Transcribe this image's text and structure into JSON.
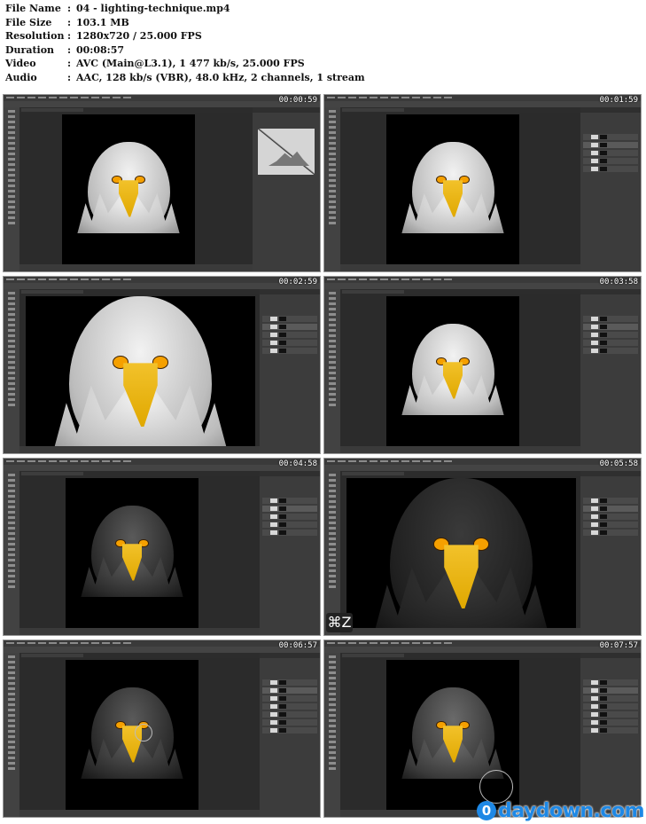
{
  "file_info": [
    {
      "key": "File Name",
      "value": "04 - lighting-technique.mp4"
    },
    {
      "key": "File Size",
      "value": "103.1 MB"
    },
    {
      "key": "Resolution",
      "value": "1280x720 / 25.000 FPS"
    },
    {
      "key": "Duration",
      "value": "00:08:57"
    },
    {
      "key": "Video",
      "value": "AVC (Main@L3.1), 1 477 kb/s, 25.000 FPS"
    },
    {
      "key": "Audio",
      "value": "AAC, 128 kb/s (VBR), 48.0 kHz, 2 channels, 1 stream"
    }
  ],
  "separator": ":",
  "thumbnails": [
    {
      "timestamp": "00:00:59",
      "variant": "white",
      "panel": "properties"
    },
    {
      "timestamp": "00:01:59",
      "variant": "white",
      "panel": "layers"
    },
    {
      "timestamp": "00:02:59",
      "variant": "white",
      "panel": "layers",
      "zoom": "large"
    },
    {
      "timestamp": "00:03:58",
      "variant": "white",
      "panel": "layers"
    },
    {
      "timestamp": "00:04:58",
      "variant": "dark",
      "panel": "layers"
    },
    {
      "timestamp": "00:05:58",
      "variant": "darker",
      "panel": "layers",
      "zoom": "large",
      "overlay": "⌘Z"
    },
    {
      "timestamp": "00:06:57",
      "variant": "dark",
      "panel": "layers",
      "brush": true
    },
    {
      "timestamp": "00:07:57",
      "variant": "mid",
      "panel": "layers",
      "brush": true
    }
  ],
  "watermark": {
    "logo": "0",
    "text": "daydown.com",
    "color": "#1e88e5"
  },
  "colors": {
    "frame_bg": "#202020",
    "panel": "#3c3c3c",
    "beak": "#e0a800",
    "eye": "#f5a000"
  }
}
